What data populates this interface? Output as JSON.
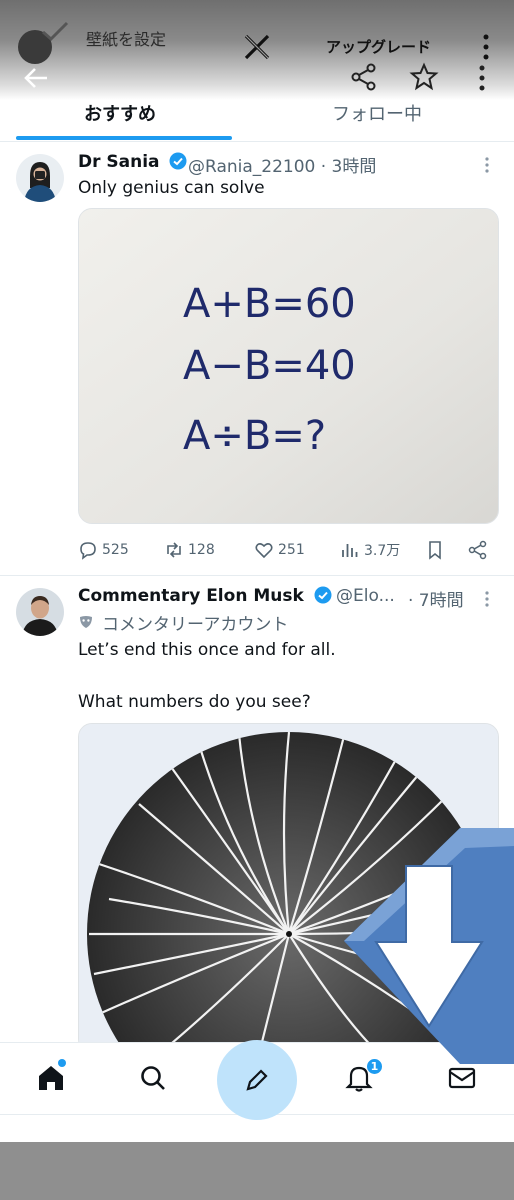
{
  "overlay": {
    "wallpaper_label": "壁紙を設定",
    "upgrade_label": "アップグレード"
  },
  "tabs": [
    {
      "label": "おすすめ",
      "active": true
    },
    {
      "label": "フォロー中",
      "active": false
    }
  ],
  "tweets": [
    {
      "name": "Dr Sania",
      "handle": "@Rania_22100 · 3時間",
      "text": "Only genius can solve",
      "image_lines": [
        "A+B=60",
        "A−B=40",
        "A÷B=?"
      ],
      "stats": {
        "replies": "525",
        "reposts": "128",
        "likes": "251",
        "views": "3.7万"
      }
    },
    {
      "name": "Commentary Elon Musk",
      "handle": "@Elo...",
      "time": "· 7時間",
      "label": "コメンタリーアカウント",
      "text_line1": "Let’s end this once and for all.",
      "text_line2": "What numbers do you see?"
    }
  ],
  "nav": {
    "notification_count": "1"
  },
  "colors": {
    "accent": "#1d9bf0",
    "text_secondary": "#536471"
  }
}
